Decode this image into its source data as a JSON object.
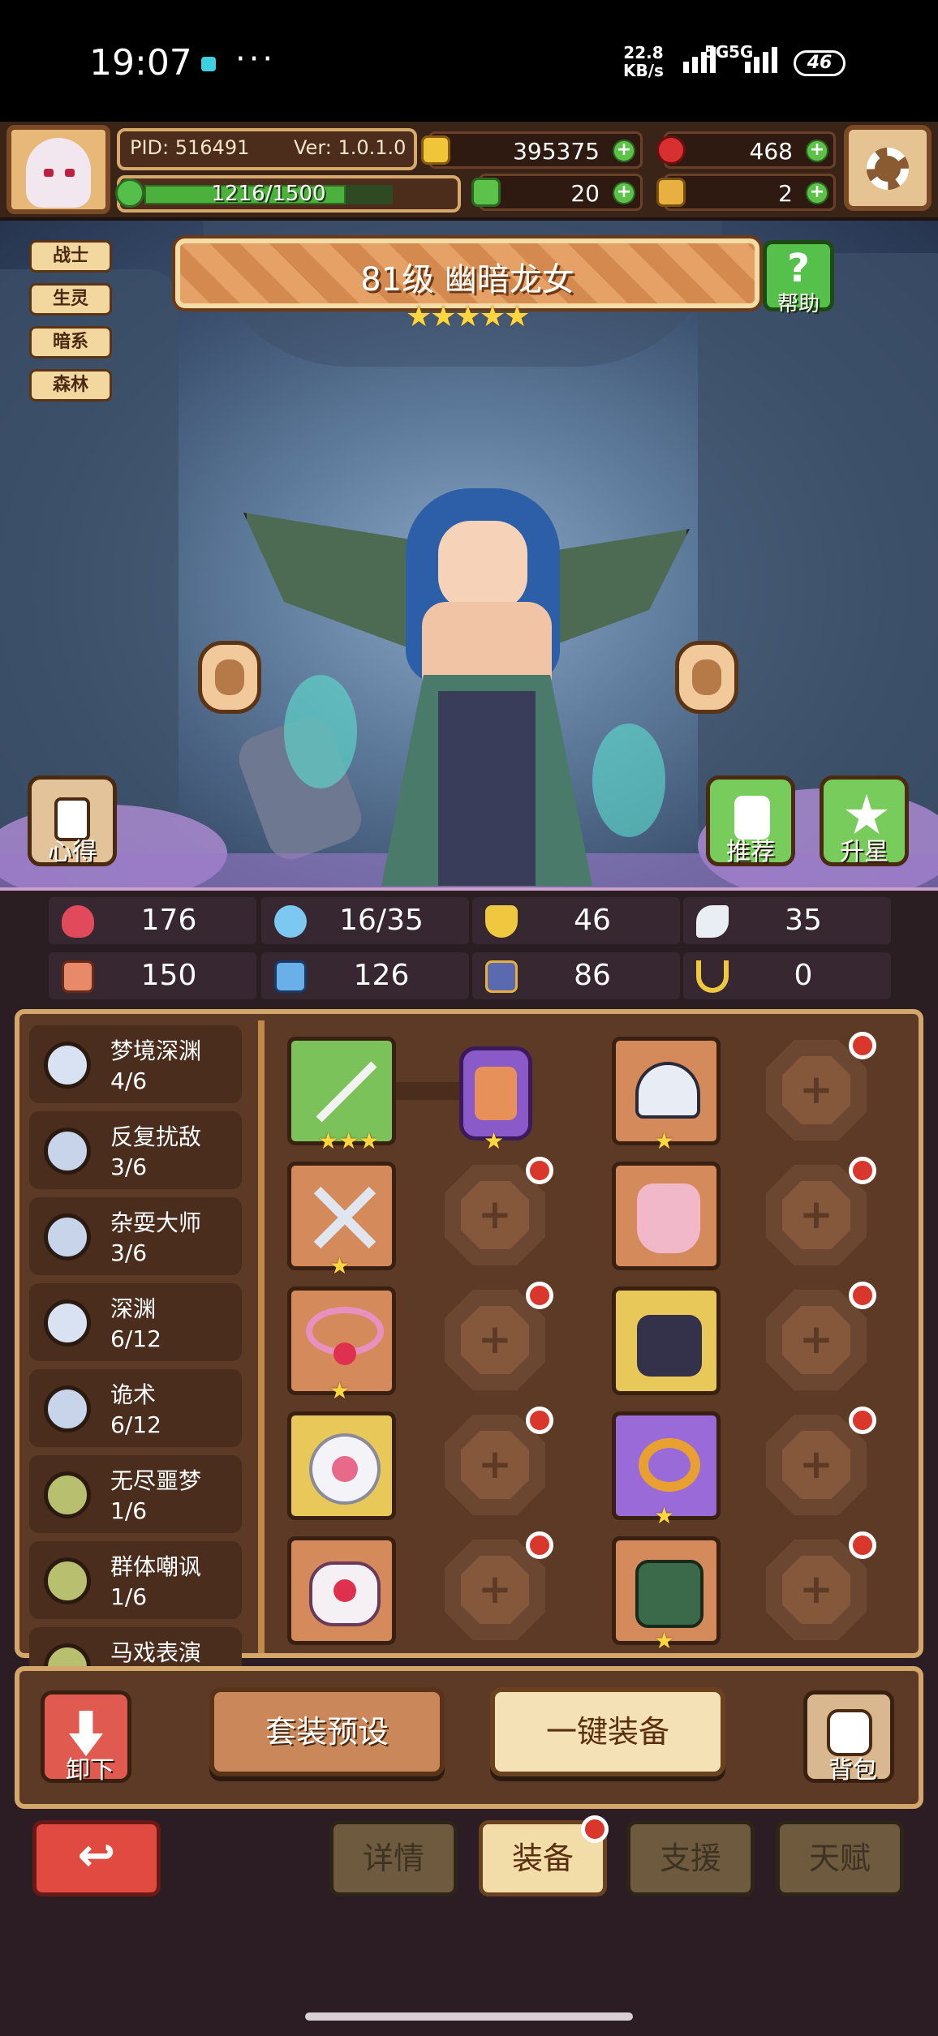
{
  "status_bar": {
    "time": "19:07",
    "more": "···",
    "net_speed_value": "22.8",
    "net_speed_unit": "KB/s",
    "signal_1": "5G",
    "signal_2": "5G",
    "battery": "46"
  },
  "resources": {
    "pid": "PID: 516491",
    "version": "Ver: 1.0.1.0",
    "exp": "1216/1500",
    "exp_fraction": 0.81,
    "gold": "395375",
    "gems": "468",
    "clover": "20",
    "keys": "2",
    "plus": "+"
  },
  "hero": {
    "tags": [
      "战士",
      "生灵",
      "暗系",
      "森林"
    ],
    "title": "81级 幽暗龙女",
    "stars": "★★★★★",
    "help_label": "帮助",
    "help_glyph": "?",
    "tips_label": "心得",
    "recommend_label": "推荐",
    "star_up_label": "升星"
  },
  "stats": {
    "hp": "176",
    "mana": "16/35",
    "armor": "46",
    "speed": "35",
    "attack": "150",
    "magic": "126",
    "cards": "86",
    "luck": "0"
  },
  "sets": [
    {
      "name": "梦境深渊",
      "count": "4/6"
    },
    {
      "name": "反复扰敌",
      "count": "3/6"
    },
    {
      "name": "杂耍大师",
      "count": "3/6"
    },
    {
      "name": "深渊",
      "count": "6/12"
    },
    {
      "name": "诡术",
      "count": "6/12"
    },
    {
      "name": "无尽噩梦",
      "count": "1/6"
    },
    {
      "name": "群体嘲讽",
      "count": "1/6"
    },
    {
      "name": "马戏表演",
      "count": ""
    }
  ],
  "equipment": {
    "weapon_stars": "★★★",
    "one_star": "★",
    "empty_plus": "+"
  },
  "actions": {
    "unequip": "卸下",
    "preset": "套装预设",
    "auto_equip": "一键装备",
    "bag": "背包"
  },
  "nav": {
    "back_glyph": "↩",
    "tabs": [
      "详情",
      "装备",
      "支援",
      "天赋"
    ],
    "active_tab": 1
  },
  "colors": {
    "panel_brown": "#5d3a26",
    "panel_border": "#d3a66a",
    "accent_green": "#55c04a",
    "alert_red": "#d9362c",
    "star_gold": "#ffd640"
  }
}
